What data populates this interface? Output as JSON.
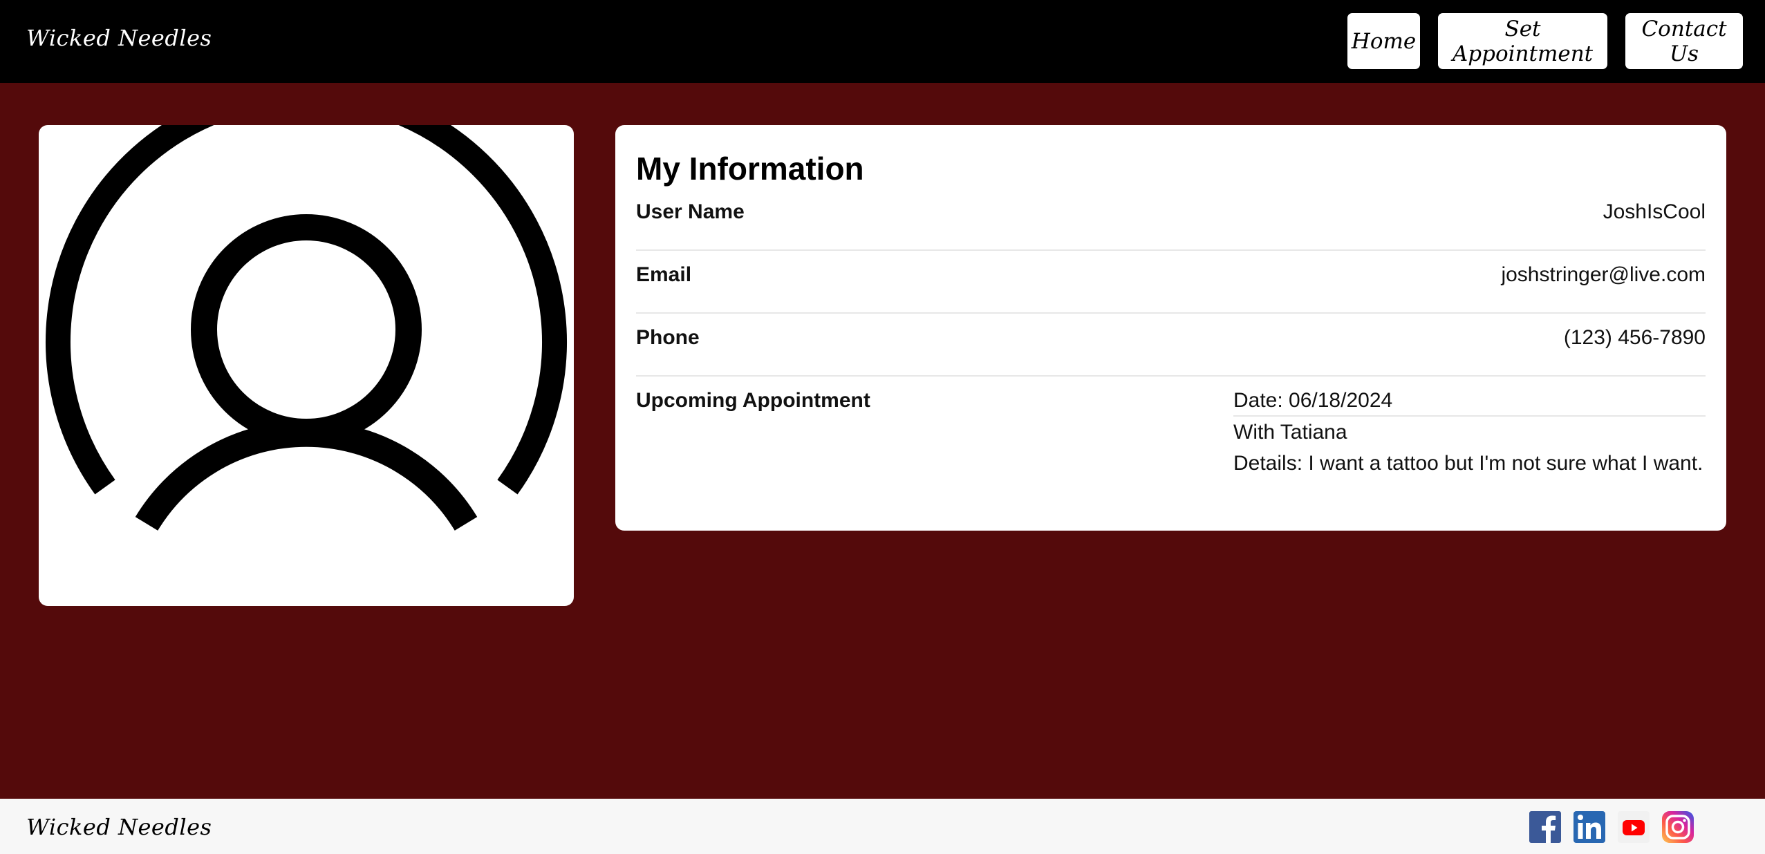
{
  "header": {
    "brand": "Wicked Needles",
    "nav": {
      "home": "Home",
      "set_appointment": "Set Appointment",
      "contact_us": "Contact Us"
    }
  },
  "avatar": {
    "icon": "user-profile-icon"
  },
  "info": {
    "title": "My Information",
    "user_name": {
      "label": "User Name",
      "value": "JoshIsCool"
    },
    "email": {
      "label": "Email",
      "value": "joshstringer@live.com"
    },
    "phone": {
      "label": "Phone",
      "value": "(123) 456-7890"
    },
    "appointment": {
      "label": "Upcoming Appointment",
      "date": "Date: 06/18/2024",
      "with": "With Tatiana",
      "details": "Details: I want a tattoo but I'm not sure what I want."
    }
  },
  "footer": {
    "brand": "Wicked Needles",
    "socials": [
      "facebook-icon",
      "linkedin-icon",
      "youtube-icon",
      "instagram-icon"
    ]
  },
  "colors": {
    "page_background": "#540a0b",
    "header_background": "#000000",
    "footer_background": "#f7f7f7",
    "card_background": "#ffffff",
    "facebook": "#3b5998",
    "linkedin": "#2867b2",
    "youtube": "#ff0000",
    "instagram": "#e1306c"
  }
}
